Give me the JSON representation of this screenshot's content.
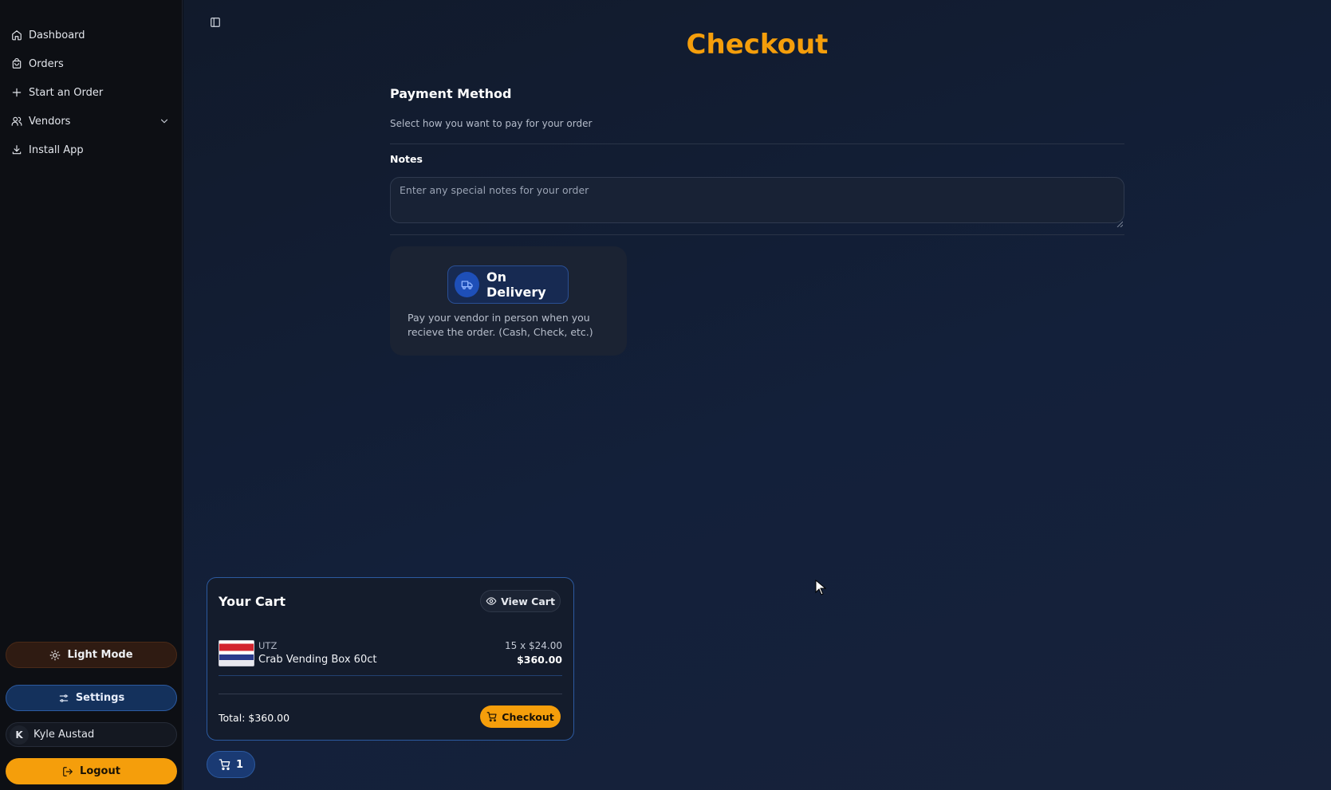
{
  "sidebar": {
    "nav": [
      {
        "label": "Dashboard",
        "icon": "home-icon"
      },
      {
        "label": "Orders",
        "icon": "bag-icon"
      },
      {
        "label": "Start an Order",
        "icon": "plus-icon"
      },
      {
        "label": "Vendors",
        "icon": "users-icon",
        "expandable": true
      },
      {
        "label": "Install App",
        "icon": "download-icon"
      }
    ],
    "light_mode_label": "Light Mode",
    "settings_label": "Settings",
    "user": {
      "initial": "K",
      "name": "Kyle Austad"
    },
    "logout_label": "Logout"
  },
  "main": {
    "title": "Checkout",
    "payment": {
      "heading": "Payment Method",
      "subheading": "Select how you want to pay for your order",
      "notes_label": "Notes",
      "notes_placeholder": "Enter any special notes for your order",
      "notes_value": "",
      "option": {
        "label": "On Delivery",
        "description": "Pay your vendor in person when you recieve the order. (Cash, Check, etc.)"
      }
    }
  },
  "cart": {
    "title": "Your Cart",
    "view_cart_label": "View Cart",
    "items": [
      {
        "vendor": "UTZ",
        "name": "Crab Vending Box 60ct",
        "qty_price": "15 x $24.00",
        "line_total": "$360.00"
      }
    ],
    "total_label": "Total: $360.00",
    "checkout_label": "Checkout",
    "badge_count": "1"
  },
  "colors": {
    "accent": "#f59e0b",
    "primary_blue": "#2c5aa0",
    "sidebar_bg": "#0d0f14",
    "main_bg": "#13203a"
  }
}
